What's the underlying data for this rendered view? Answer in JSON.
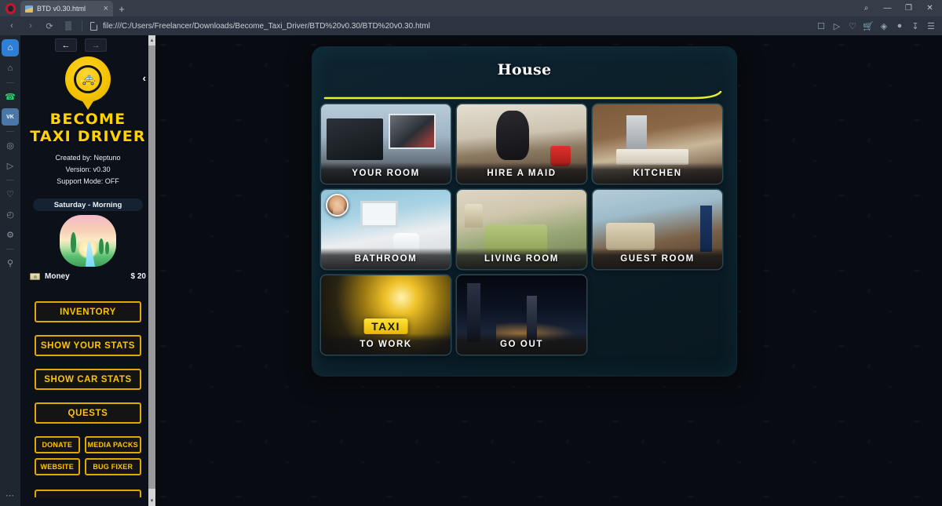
{
  "browser": {
    "tab": {
      "title": "BTD v0.30.html",
      "close": "×"
    },
    "new_tab": "+",
    "window_controls": {
      "search": "⌕",
      "minimize": "—",
      "restore": "❐",
      "close": "✕"
    },
    "nav": {
      "back": "‹",
      "forward": "›",
      "reload": "⟳",
      "tiles": "▒"
    },
    "url": "file:///C:/Users/Freelancer/Downloads/Become_Taxi_Driver/BTD%20v0.30/BTD%20v0.30.html",
    "address_icons": [
      "camera-icon",
      "send-icon",
      "heart-icon",
      "cart-icon",
      "cube-icon",
      "profile-icon",
      "download-icon",
      "menu-icon"
    ],
    "rail_items": [
      {
        "name": "opera-home",
        "glyph": "⌂",
        "active": true
      },
      {
        "name": "pinboards",
        "glyph": "⌂",
        "active": false
      },
      {
        "name": "whatsapp",
        "glyph": "✆",
        "active": false
      },
      {
        "name": "vk",
        "glyph": "VK",
        "active": false
      },
      {
        "name": "player",
        "glyph": "◎",
        "active": false
      },
      {
        "name": "telegram",
        "glyph": "▷",
        "active": false
      },
      {
        "name": "favorites",
        "glyph": "♡",
        "active": false
      },
      {
        "name": "history",
        "glyph": "◴",
        "active": false
      },
      {
        "name": "settings",
        "glyph": "⚙",
        "active": false
      },
      {
        "name": "pin",
        "glyph": "⚑",
        "active": false
      }
    ],
    "rail_more": "⋯"
  },
  "sidebar": {
    "nav": {
      "back": "←",
      "forward": "→",
      "collapse": "‹"
    },
    "logo": {
      "glyph": "Ὡ5",
      "taxi_icon": "taxi-icon"
    },
    "title_line1": "BECOME",
    "title_line2": "TAXI DRIVER",
    "meta": [
      "Created by:  Neptuno",
      "Version: v0.30",
      "Support Mode: OFF"
    ],
    "day_time": "Saturday - Morning",
    "money": {
      "label": "Money",
      "value": "$ 20"
    },
    "buttons": [
      "INVENTORY",
      "SHOW YOUR STATS",
      "SHOW CAR STATS",
      "QUESTS"
    ],
    "mini_buttons": [
      "DONATE",
      "MEDIA PACKS",
      "WEBSITE",
      "BUG FIXER"
    ]
  },
  "main": {
    "panel_title": "House",
    "accent_color": "#e8f02a",
    "cards": [
      {
        "label": "YOUR ROOM",
        "art": "art-room",
        "avatar": false
      },
      {
        "label": "HIRE A MAID",
        "art": "art-maid",
        "avatar": false
      },
      {
        "label": "KITCHEN",
        "art": "art-kitchen",
        "avatar": false
      },
      {
        "label": "BATHROOM",
        "art": "art-bath",
        "avatar": true
      },
      {
        "label": "LIVING ROOM",
        "art": "art-living",
        "avatar": false
      },
      {
        "label": "GUEST ROOM",
        "art": "art-guest",
        "avatar": false
      },
      {
        "label": "TO WORK",
        "art": "art-work",
        "avatar": false,
        "overlay": "TAXI"
      },
      {
        "label": "GO OUT",
        "art": "art-go",
        "avatar": false
      }
    ]
  }
}
